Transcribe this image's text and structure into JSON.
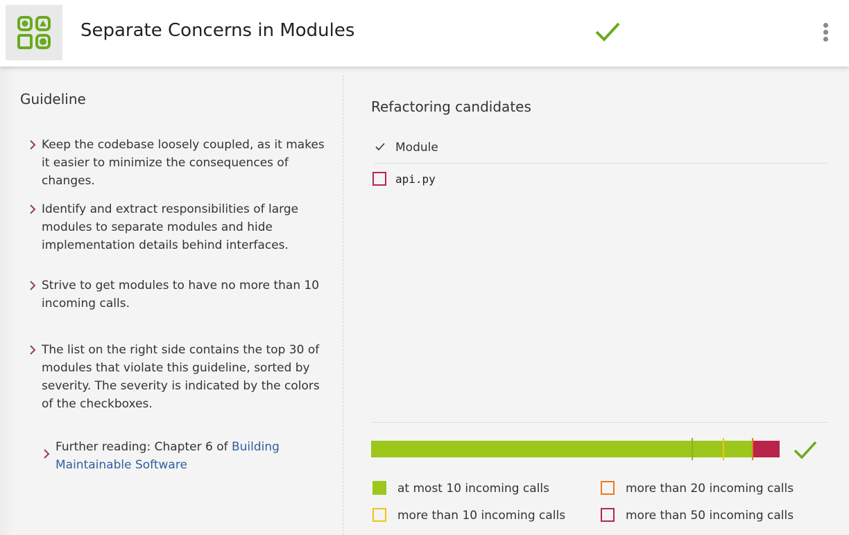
{
  "header": {
    "title": "Separate Concerns in Modules",
    "logo_icon": "shapes-grid-icon",
    "status_icon": "checkmark-icon",
    "menu_icon": "more-vertical-icon"
  },
  "guideline": {
    "title": "Guideline",
    "items": [
      "Keep the codebase loosely coupled, as it makes it easier to minimize the consequences of changes.",
      "Identify and extract responsibilities of large modules to separate modules and hide implementation details behind interfaces.",
      "Strive to get modules to have no more than 10 incoming calls.",
      "The list on the right side contains the top 30 of modules that violate this guideline, sorted by severity. The severity is indicated by the colors of the checkboxes."
    ],
    "further_reading": {
      "prefix": "Further reading: Chapter 6 of ",
      "link": "Building Maintainable Software"
    }
  },
  "candidates": {
    "title": "Refactoring candidates",
    "column_header": "Module",
    "rows": [
      {
        "label": "api.py",
        "severity_color": "#b8244a"
      }
    ]
  },
  "distribution": {
    "segments": [
      {
        "fraction": 0.786,
        "color": "#9dc71c"
      },
      {
        "fraction": 0.077,
        "color": "#9dc71c"
      },
      {
        "fraction": 0.07,
        "color": "#9dc71c"
      },
      {
        "fraction": 0.067,
        "color": "#b8244a"
      }
    ],
    "markers": [
      {
        "color": "#8ab51a"
      },
      {
        "color": "#f0c419"
      },
      {
        "color": "#ea7b1e"
      }
    ]
  },
  "legend": [
    {
      "label": "at most 10 incoming calls",
      "color": "#9dc71c",
      "filled": true
    },
    {
      "label": "more than 20 incoming calls",
      "color": "#ea7b1e",
      "filled": false
    },
    {
      "label": "more than 10 incoming calls",
      "color": "#f0c419",
      "filled": false
    },
    {
      "label": "more than 50 incoming calls",
      "color": "#b8244a",
      "filled": false
    }
  ],
  "colors": {
    "accent_green": "#6aaa1f",
    "chevron": "#9a3a5a",
    "link": "#2f5f9e"
  }
}
